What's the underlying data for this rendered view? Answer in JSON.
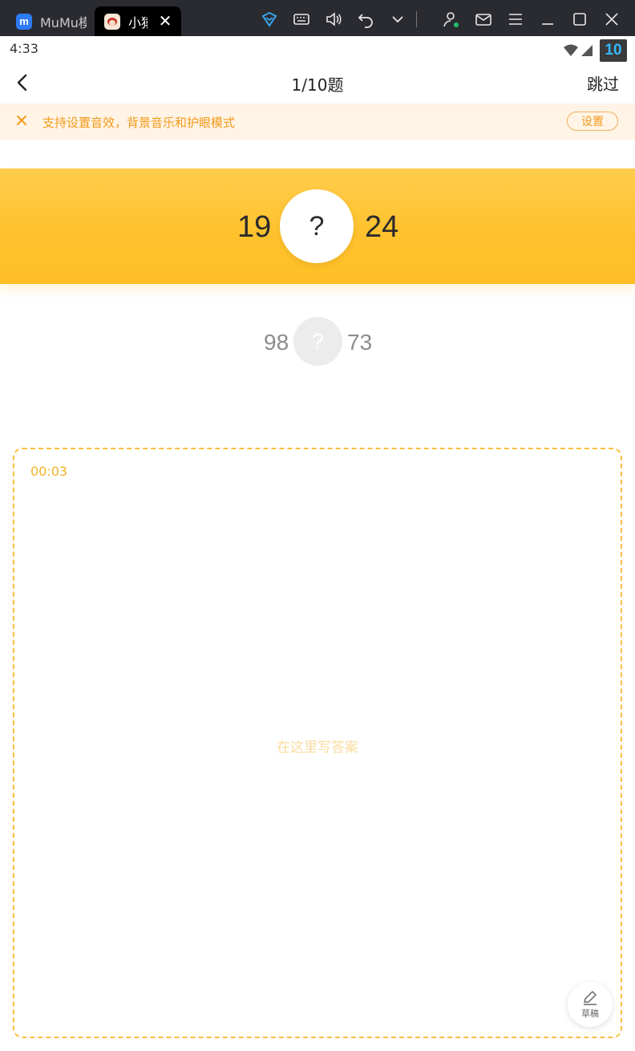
{
  "window": {
    "tabs": [
      {
        "label": "MuMu模拟器"
      },
      {
        "label": "小猿口算"
      }
    ]
  },
  "statusbar": {
    "time": "4:33",
    "badge": "10"
  },
  "appbar": {
    "title": "1/10题",
    "skip_label": "跳过"
  },
  "tip": {
    "text": "支持设置音效，背景音乐和护眼模式",
    "button_label": "设置"
  },
  "question": {
    "left": "19",
    "mark": "?",
    "right": "24"
  },
  "next_question": {
    "left": "98",
    "mark": "?",
    "right": "73"
  },
  "answer": {
    "timer": "00:03",
    "placeholder": "在这里写答案",
    "draft_label": "草稿"
  },
  "colors": {
    "accent": "#ffc22e",
    "tip_bg": "#fff4e5",
    "tip_text": "#f29a1a",
    "dash_border": "#f7c23a"
  },
  "icons": [
    "mumu-logo-icon",
    "app-logo-icon",
    "close-icon",
    "gamepad-icon",
    "keyboard-icon",
    "volume-icon",
    "undo-icon",
    "chevron-down-icon",
    "user-icon",
    "mail-icon",
    "menu-icon",
    "minimize-icon",
    "maximize-icon",
    "wifi-icon",
    "signal-icon",
    "back-arrow-icon",
    "pencil-icon"
  ]
}
